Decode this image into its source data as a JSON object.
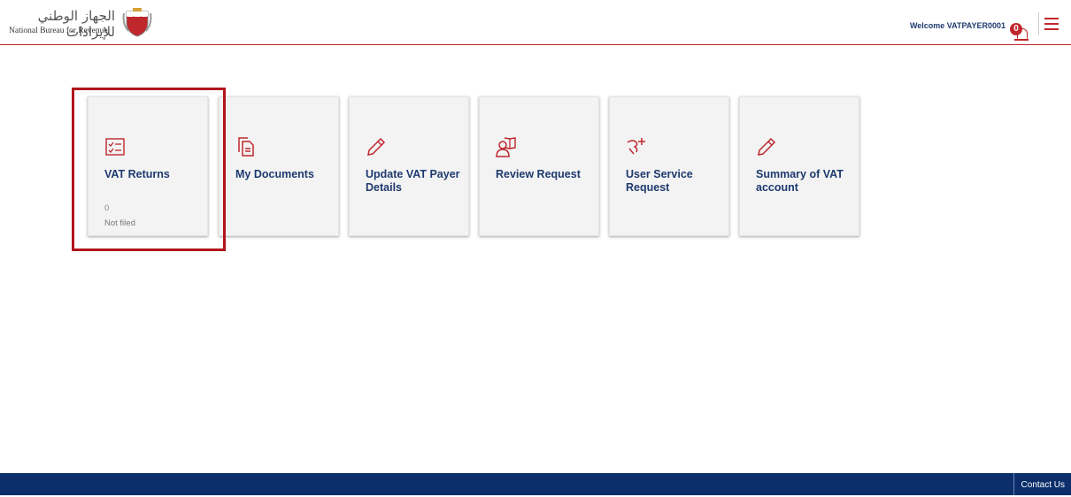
{
  "header": {
    "logo_arabic": "الجهاز الوطني للإيرادات",
    "logo_english": "National Bureau for Revenue",
    "welcome": "Welcome VATPAYER0001",
    "notification_count": "0"
  },
  "cards": [
    {
      "title": "VAT Returns",
      "count": "0",
      "status": "Not filed",
      "icon": "checklist-icon"
    },
    {
      "title": "My Documents",
      "icon": "documents-icon"
    },
    {
      "title": "Update VAT Payer Details",
      "icon": "pencil-icon"
    },
    {
      "title": "Review Request",
      "icon": "user-book-icon"
    },
    {
      "title": "User Service Request",
      "icon": "user-add-icon"
    },
    {
      "title": "Summary of VAT account",
      "icon": "pencil-icon"
    }
  ],
  "footer": {
    "contact": "Contact Us"
  },
  "colors": {
    "accent": "#c0272d",
    "title_text": "#1e3a6e",
    "footer_bg": "#0c2f6b",
    "highlight": "#b0141c"
  }
}
